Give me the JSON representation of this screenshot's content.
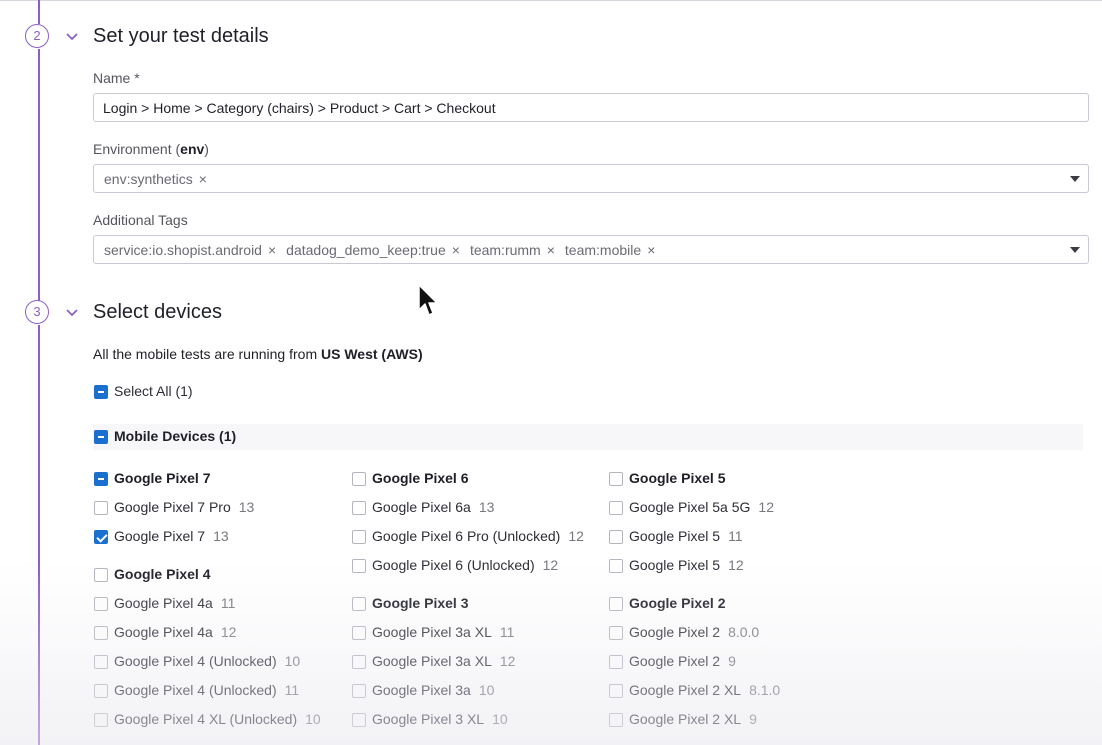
{
  "step2": {
    "number": "2",
    "title": "Set your test details",
    "name_label": "Name *",
    "name_value": "Login > Home > Category (chairs) > Product > Cart > Checkout",
    "env_label_prefix": "Environment (",
    "env_label_bold": "env",
    "env_label_suffix": ")",
    "env_tags": [
      "env:synthetics"
    ],
    "tags_label": "Additional Tags",
    "tags": [
      "service:io.shopist.android",
      "datadog_demo_keep:true",
      "team:rumm",
      "team:mobile"
    ],
    "remove_glyph": "×"
  },
  "step3": {
    "number": "3",
    "title": "Select devices",
    "info_prefix": "All the mobile tests are running from ",
    "info_location": "US West (AWS)",
    "select_all_label": "Select All (1)",
    "select_all_state": "partial",
    "group_label": "Mobile Devices (1)",
    "group_state": "partial"
  },
  "columns": [
    {
      "groups": [
        {
          "label": "Google Pixel 7",
          "state": "partial",
          "items": [
            {
              "label": "Google Pixel 7 Pro",
              "version": "13",
              "state": "unchecked"
            },
            {
              "label": "Google Pixel 7",
              "version": "13",
              "state": "checked"
            }
          ]
        },
        {
          "label": "Google Pixel 4",
          "state": "unchecked",
          "items": [
            {
              "label": "Google Pixel 4a",
              "version": "11",
              "state": "unchecked"
            },
            {
              "label": "Google Pixel 4a",
              "version": "12",
              "state": "unchecked"
            },
            {
              "label": "Google Pixel 4 (Unlocked)",
              "version": "10",
              "state": "unchecked"
            },
            {
              "label": "Google Pixel 4 (Unlocked)",
              "version": "11",
              "state": "unchecked"
            },
            {
              "label": "Google Pixel 4 XL (Unlocked)",
              "version": "10",
              "state": "unchecked"
            }
          ]
        }
      ]
    },
    {
      "groups": [
        {
          "label": "Google Pixel 6",
          "state": "unchecked",
          "items": [
            {
              "label": "Google Pixel 6a",
              "version": "13",
              "state": "unchecked"
            },
            {
              "label": "Google Pixel 6 Pro (Unlocked)",
              "version": "12",
              "state": "unchecked"
            },
            {
              "label": "Google Pixel 6 (Unlocked)",
              "version": "12",
              "state": "unchecked"
            }
          ]
        },
        {
          "label": "Google Pixel 3",
          "state": "unchecked",
          "items": [
            {
              "label": "Google Pixel 3a XL",
              "version": "11",
              "state": "unchecked"
            },
            {
              "label": "Google Pixel 3a XL",
              "version": "12",
              "state": "unchecked"
            },
            {
              "label": "Google Pixel 3a",
              "version": "10",
              "state": "unchecked"
            },
            {
              "label": "Google Pixel 3 XL",
              "version": "10",
              "state": "unchecked"
            }
          ]
        }
      ]
    },
    {
      "groups": [
        {
          "label": "Google Pixel 5",
          "state": "unchecked",
          "items": [
            {
              "label": "Google Pixel 5a 5G",
              "version": "12",
              "state": "unchecked"
            },
            {
              "label": "Google Pixel 5",
              "version": "11",
              "state": "unchecked"
            },
            {
              "label": "Google Pixel 5",
              "version": "12",
              "state": "unchecked"
            }
          ]
        },
        {
          "label": "Google Pixel 2",
          "state": "unchecked",
          "items": [
            {
              "label": "Google Pixel 2",
              "version": "8.0.0",
              "state": "unchecked"
            },
            {
              "label": "Google Pixel 2",
              "version": "9",
              "state": "unchecked"
            },
            {
              "label": "Google Pixel 2 XL",
              "version": "8.1.0",
              "state": "unchecked"
            },
            {
              "label": "Google Pixel 2 XL",
              "version": "9",
              "state": "unchecked"
            }
          ]
        }
      ]
    }
  ],
  "colors": {
    "accent": "#8c5fc4",
    "checkbox_checked": "#1a6fcf"
  }
}
